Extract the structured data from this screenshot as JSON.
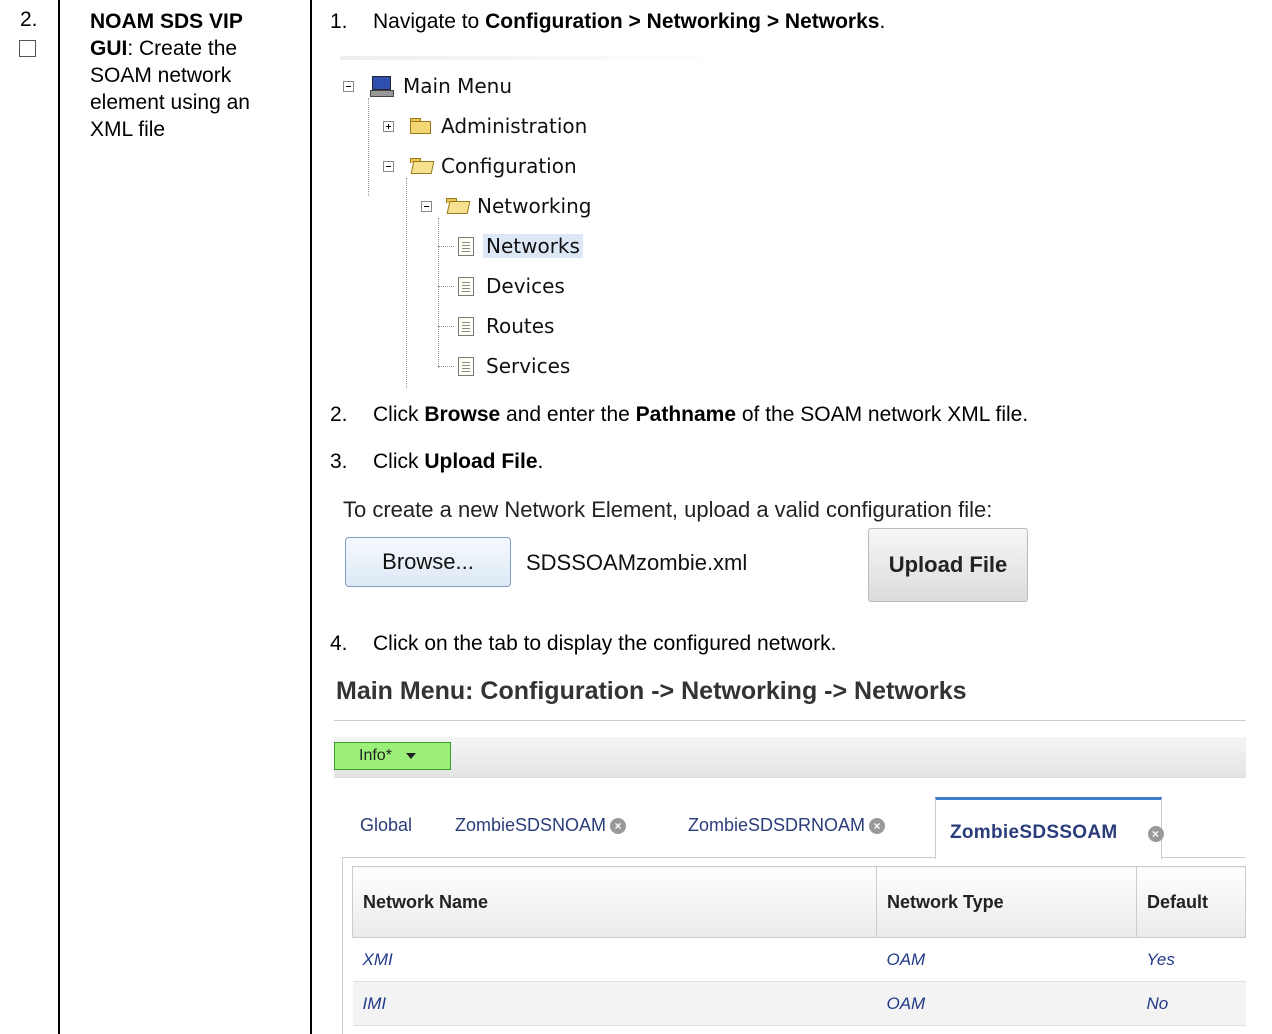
{
  "step": {
    "number": "2.",
    "title_bold": "NOAM SDS VIP GUI",
    "title_rest": ": Create the SOAM network element using an XML file"
  },
  "instructions": [
    {
      "num": "1.",
      "pre": "Navigate to ",
      "bold": "Configuration > Networking > Networks",
      "post": "."
    },
    {
      "num": "2.",
      "pre": "Click ",
      "bold": "Browse",
      "mid": " and enter the ",
      "bold2": "Pathname",
      "post": " of the SOAM network XML file."
    },
    {
      "num": "3.",
      "pre": "Click ",
      "bold": "Upload File",
      "post": "."
    },
    {
      "num": "4.",
      "pre": "Click on the tab to display the configured network."
    }
  ],
  "tree": {
    "main_menu": "Main Menu",
    "administration": "Administration",
    "configuration": "Configuration",
    "networking": "Networking",
    "networks": "Networks",
    "devices": "Devices",
    "routes": "Routes",
    "services": "Services"
  },
  "upload": {
    "prompt": "To create a new Network Element, upload a valid configuration file:",
    "browse_label": "Browse...",
    "filename": "SDSSOAMzombie.xml",
    "upload_label": "Upload File"
  },
  "networks_page": {
    "title": "Main Menu: Configuration -> Networking -> Networks",
    "info_button": "Info*",
    "tabs": [
      "Global",
      "ZombieSDSNOAM",
      "ZombieSDSDRNOAM",
      "ZombieSDSSOAM"
    ],
    "columns": [
      "Network Name",
      "Network Type",
      "Default"
    ],
    "rows": [
      [
        "XMI",
        "OAM",
        "Yes"
      ],
      [
        "IMI",
        "OAM",
        "No"
      ]
    ]
  },
  "colors": {
    "info_button": "#9cf07a",
    "active_tab_border": "#3d7cc9",
    "link_text": "#223a8a"
  }
}
